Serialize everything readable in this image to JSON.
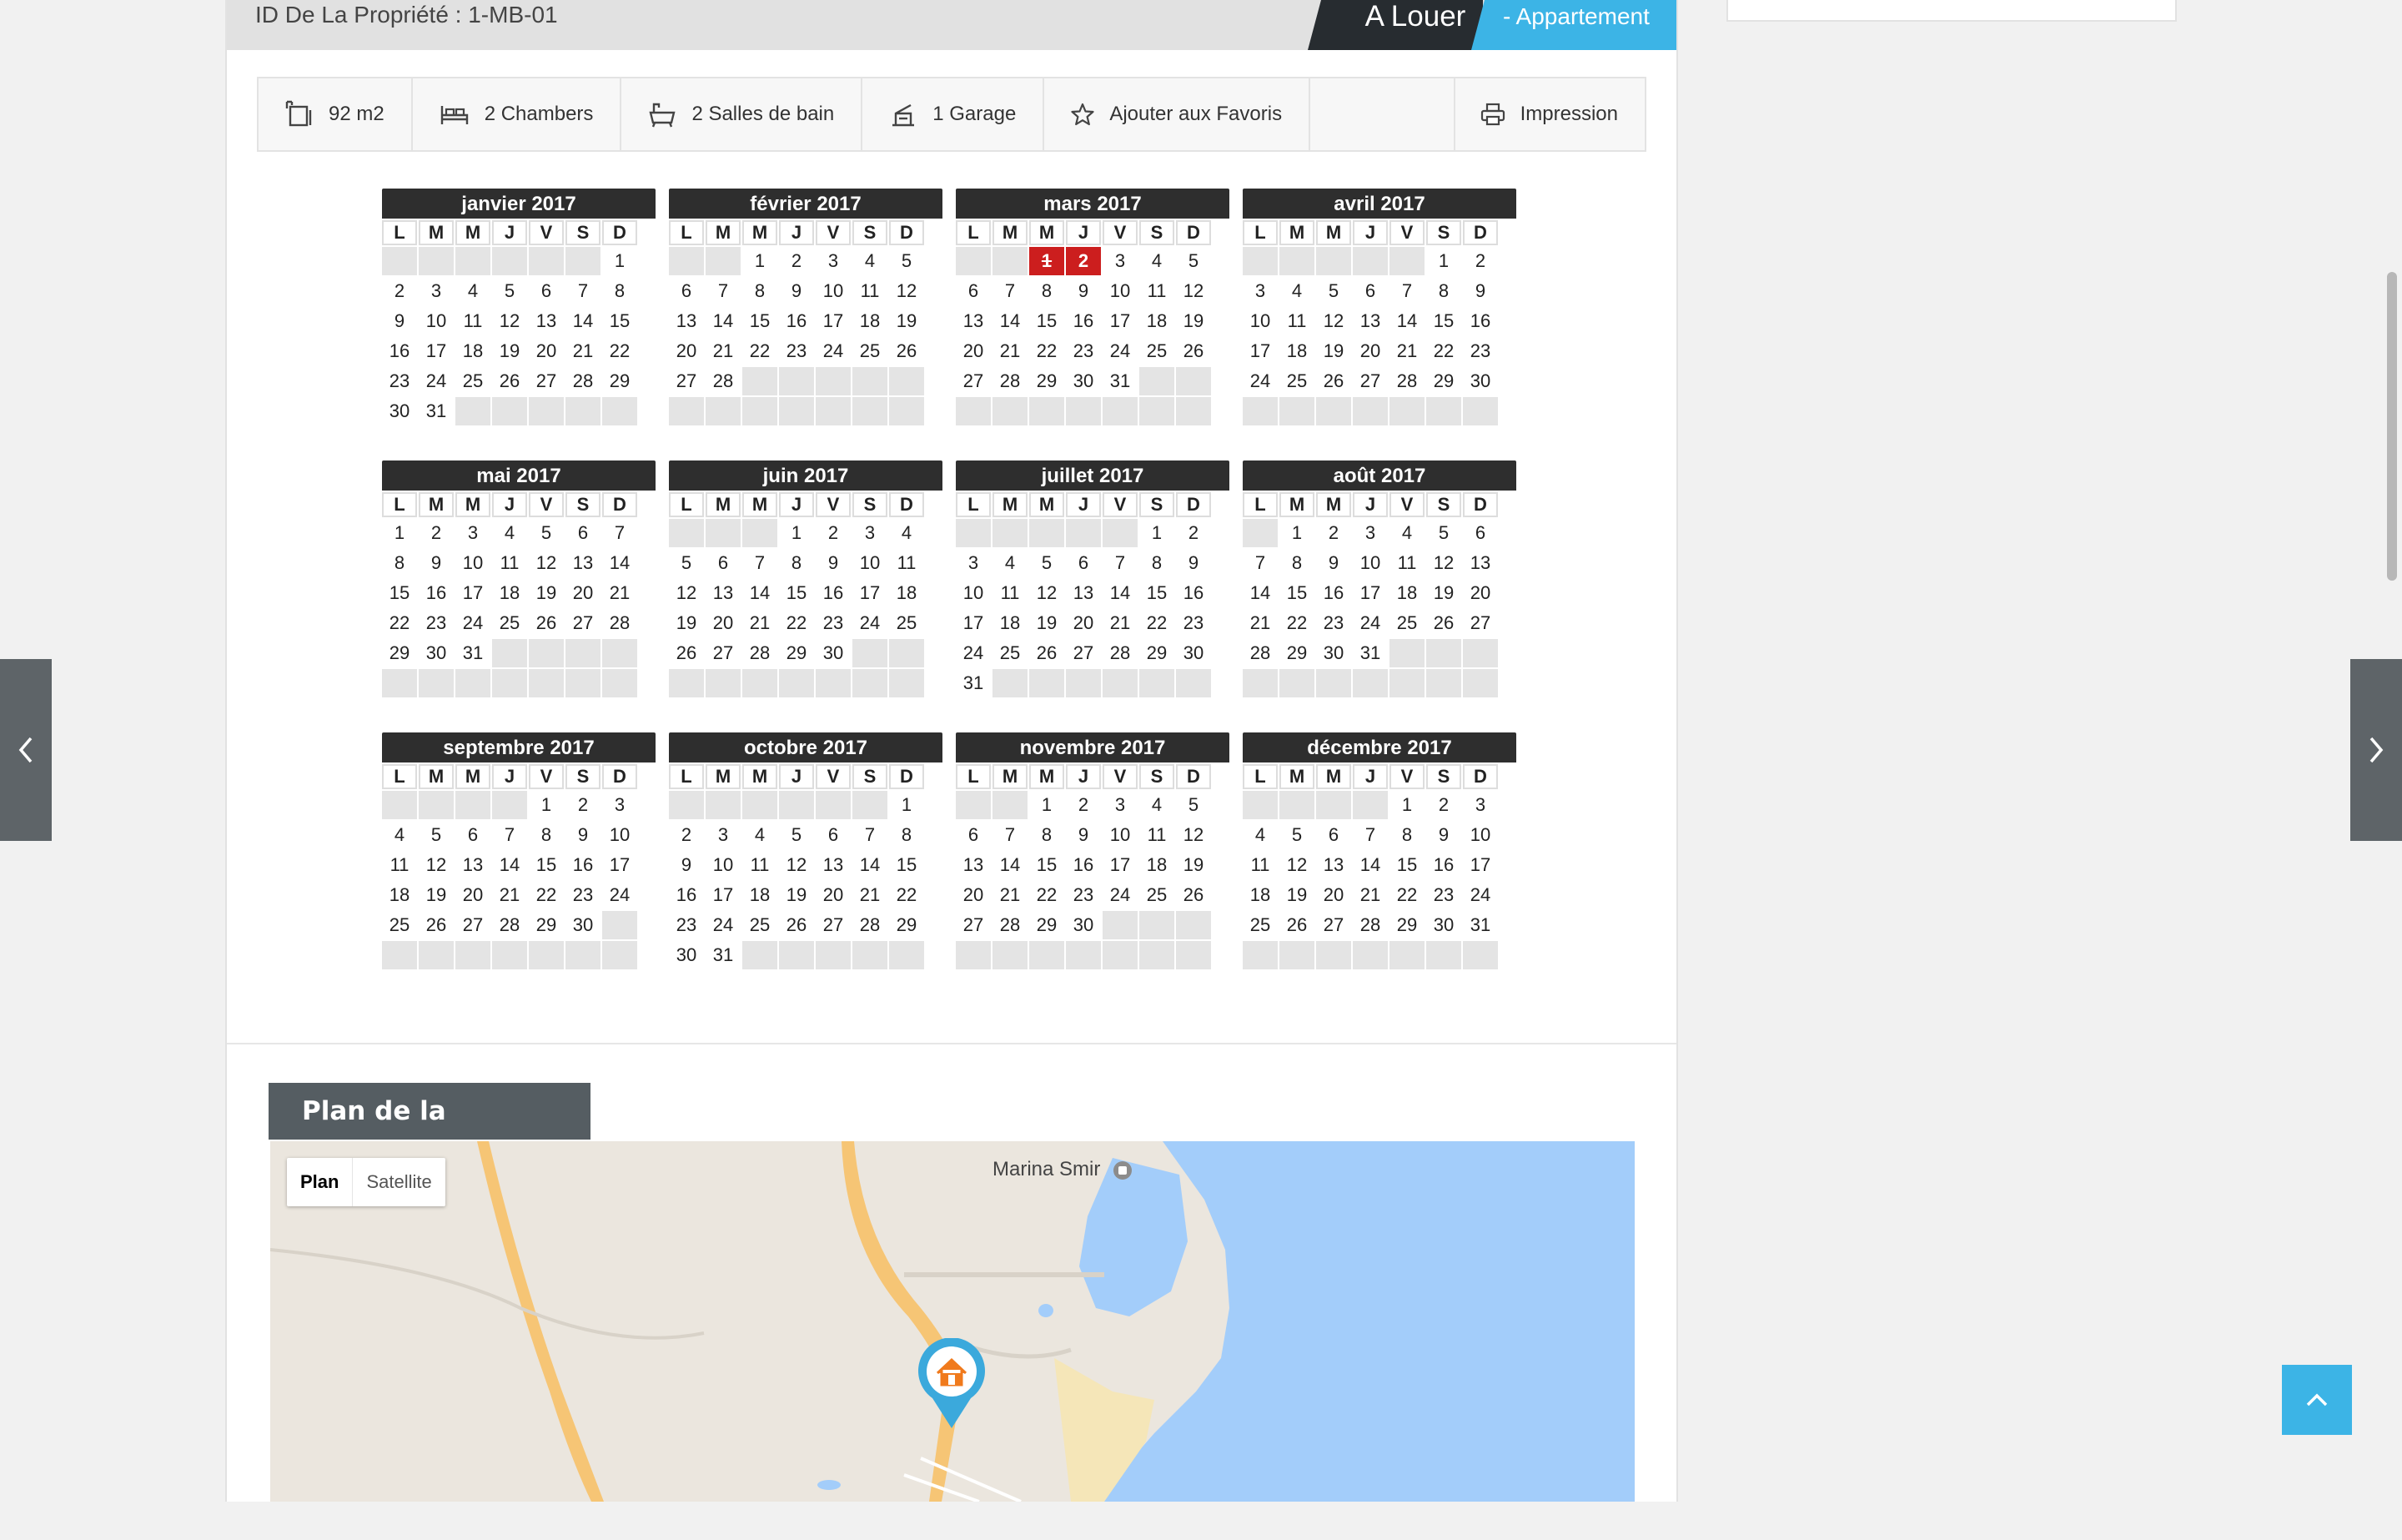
{
  "property": {
    "id_label": "ID De La Propriété : 1-MB-01",
    "status_tag": "A Louer",
    "type_tag": "- Appartement"
  },
  "features": {
    "area": "92 m2",
    "bedrooms": "2 Chambers",
    "bathrooms": "2 Salles de bain",
    "garage": "1 Garage",
    "favorite": "Ajouter aux Favoris",
    "print": "Impression"
  },
  "calendar": {
    "weekdays": [
      "L",
      "M",
      "M",
      "J",
      "V",
      "S",
      "D"
    ],
    "months": [
      {
        "name": "janvier 2017",
        "offset": 6,
        "days": 31,
        "booked": []
      },
      {
        "name": "février 2017",
        "offset": 2,
        "days": 28,
        "booked": []
      },
      {
        "name": "mars 2017",
        "offset": 2,
        "days": 31,
        "booked": [
          1,
          2
        ]
      },
      {
        "name": "avril 2017",
        "offset": 5,
        "days": 30,
        "booked": []
      },
      {
        "name": "mai 2017",
        "offset": 0,
        "days": 31,
        "booked": []
      },
      {
        "name": "juin 2017",
        "offset": 3,
        "days": 30,
        "booked": []
      },
      {
        "name": "juillet 2017",
        "offset": 5,
        "days": 31,
        "booked": []
      },
      {
        "name": "août 2017",
        "offset": 1,
        "days": 31,
        "booked": []
      },
      {
        "name": "septembre 2017",
        "offset": 4,
        "days": 30,
        "booked": []
      },
      {
        "name": "octobre 2017",
        "offset": 6,
        "days": 31,
        "booked": []
      },
      {
        "name": "novembre 2017",
        "offset": 2,
        "days": 30,
        "booked": []
      },
      {
        "name": "décembre 2017",
        "offset": 4,
        "days": 31,
        "booked": []
      }
    ]
  },
  "map": {
    "title": "Plan de la propriété",
    "type_plan": "Plan",
    "type_satellite": "Satellite",
    "poi_label": "Marina Smir",
    "colors": {
      "water": "#a3cdfa",
      "land": "#ebe6de",
      "road": "#f6c575",
      "marker": "#3ba9dc",
      "marker_icon": "#f07a1c"
    }
  },
  "icons": {
    "area": "area-icon",
    "bed": "bed-icon",
    "bath": "bath-icon",
    "garage": "garage-icon",
    "favorite": "star-icon",
    "print": "printer-icon",
    "nav_left": "chevron-left-icon",
    "nav_right": "chevron-right-icon",
    "back_to_top": "chevron-up-icon"
  }
}
